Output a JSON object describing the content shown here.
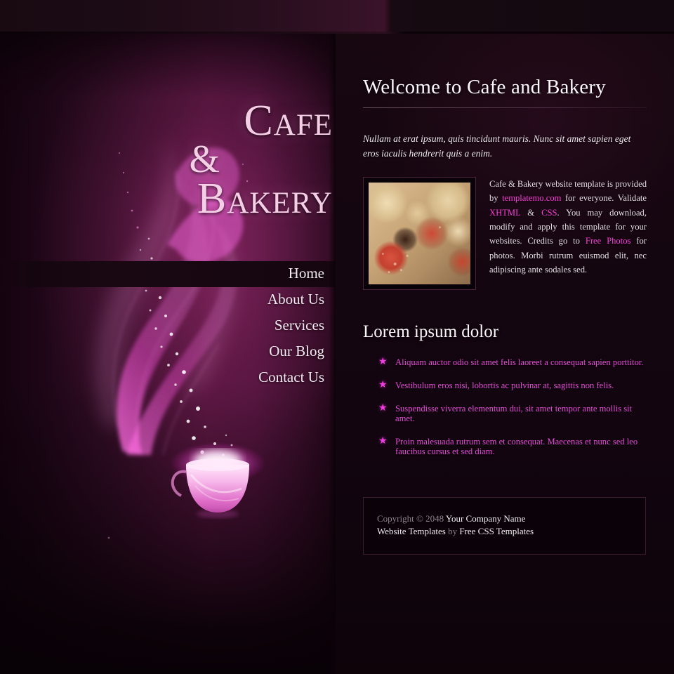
{
  "site": {
    "logo_line1": "Cafe",
    "logo_line2": "&",
    "logo_line3": "Bakery",
    "accent_color": "#ff3ddc",
    "list_color": "#e64bd8",
    "panel_color": "#5d1743"
  },
  "nav": {
    "items": [
      {
        "label": "Home",
        "active": true
      },
      {
        "label": "About Us",
        "active": false
      },
      {
        "label": "Services",
        "active": false
      },
      {
        "label": "Our Blog",
        "active": false
      },
      {
        "label": "Contact Us",
        "active": false
      }
    ]
  },
  "main": {
    "page_title": "Welcome to Cafe and Bakery",
    "intro": "Nullam at erat ipsum, quis tincidunt mauris. Nunc sit amet sapien eget eros iaculis hendrerit quis a enim.",
    "body": {
      "part1": "Cafe & Bakery website template is provided by ",
      "link1": "templatemo.com",
      "part2": " for everyone. Validate ",
      "link2": "XHTML",
      "part3": " & ",
      "link3": "CSS",
      "part4": ". You may download, modify and apply this template for your websites. Credits go to ",
      "link4": "Free Photos",
      "part5": " for photos. Morbi rutrum euismod elit, nec adipiscing ante sodales sed."
    },
    "figure_alt": "cereal-with-strawberries-photo",
    "section_title": "Lorem ipsum dolor",
    "bullet_glyph": "★",
    "list_items": [
      "Aliquam auctor odio sit amet felis laoreet a consequat sapien porttitor.",
      "Vestibulum eros nisi, lobortis ac pulvinar at, sagittis non felis.",
      "Suspendisse viverra elementum dui, sit amet tempor ante mollis sit amet.",
      "Proin malesuada rutrum sem et consequat. Maecenas et nunc sed leo faucibus cursus et sed diam."
    ]
  },
  "footer": {
    "copyright_prefix": "Copyright © 2048",
    "company": "Your Company Name",
    "templates_label": "Website Templates",
    "by": "by",
    "credit": "Free CSS Templates"
  }
}
